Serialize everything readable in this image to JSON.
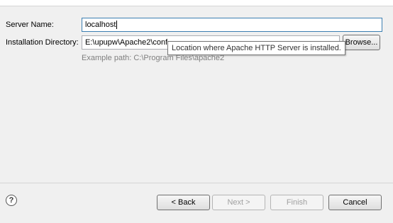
{
  "form": {
    "server_name_label": "Server Name:",
    "server_name_value": "localhost",
    "install_dir_label": "Installation Directory:",
    "install_dir_value": "E:\\upupw\\Apache2\\conf",
    "browse_label": "Browse...",
    "tooltip_text": "Location where Apache HTTP Server is installed.",
    "example_path": "Example path: C:\\Program Files\\apache2"
  },
  "buttons": {
    "help_icon": "?",
    "back": "< Back",
    "next": "Next >",
    "finish": "Finish",
    "cancel": "Cancel"
  }
}
